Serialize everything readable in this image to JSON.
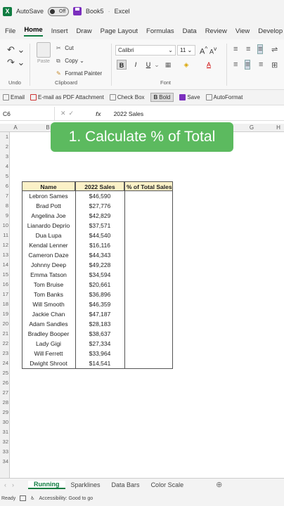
{
  "titlebar": {
    "autosave": "AutoSave",
    "toggle": "Off",
    "book": "Book5",
    "app": "Excel"
  },
  "menu": [
    "File",
    "Home",
    "Insert",
    "Draw",
    "Page Layout",
    "Formulas",
    "Data",
    "Review",
    "View",
    "Develop"
  ],
  "ribbon": {
    "clipboard": {
      "paste": "Paste",
      "cut": "Cut",
      "copy": "Copy",
      "format_painter": "Format Painter",
      "label": "Clipboard"
    },
    "undo_label": "Undo",
    "font": {
      "name": "Calibri",
      "size": "11",
      "grow": "A",
      "shrink": "A",
      "label": "Font"
    }
  },
  "qat": {
    "email": "Email",
    "pdf": "E-mail as PDF Attachment",
    "check": "Check Box",
    "bold": "Bold",
    "save": "Save",
    "autoformat": "AutoFormat"
  },
  "formula": {
    "cell": "C6",
    "fx": "fx",
    "value": "2022 Sales"
  },
  "columns": [
    "A",
    "B",
    "G",
    "H"
  ],
  "banner": "1. Calculate % of Total",
  "table": {
    "headers": [
      "Name",
      "2022 Sales",
      "% of Total Sales"
    ],
    "rows": [
      [
        "Lebron Sames",
        "$46,590"
      ],
      [
        "Brad Pott",
        "$27,776"
      ],
      [
        "Angelina Joe",
        "$42,829"
      ],
      [
        "Lianardo Deprio",
        "$37,571"
      ],
      [
        "Dua Lupa",
        "$44,540"
      ],
      [
        "Kendal Lenner",
        "$16,116"
      ],
      [
        "Cameron Daze",
        "$44,343"
      ],
      [
        "Johnny Deep",
        "$49,228"
      ],
      [
        "Emma Tatson",
        "$34,594"
      ],
      [
        "Tom Bruise",
        "$20,661"
      ],
      [
        "Tom Banks",
        "$36,896"
      ],
      [
        "Will Smooth",
        "$46,359"
      ],
      [
        "Jackie Chan",
        "$47,187"
      ],
      [
        "Adam Sandles",
        "$28,183"
      ],
      [
        "Bradley Booper",
        "$38,637"
      ],
      [
        "Lady Gigi",
        "$27,334"
      ],
      [
        "Will Ferrett",
        "$33,964"
      ],
      [
        "Dwight Shroot",
        "$14,541"
      ]
    ]
  },
  "rows_numbers": [
    "1",
    "2",
    "3",
    "4",
    "5",
    "6",
    "7",
    "8",
    "9",
    "10",
    "11",
    "12",
    "13",
    "14",
    "15",
    "16",
    "17",
    "18",
    "19",
    "20",
    "21",
    "22",
    "23",
    "24",
    "25",
    "26",
    "27",
    "28",
    "29",
    "30",
    "31",
    "32",
    "33",
    "34"
  ],
  "tabs": [
    "Running",
    "Sparklines",
    "Data Bars",
    "Color Scale"
  ],
  "status": {
    "ready": "Ready",
    "accessibility": "Accessibility: Good to go"
  }
}
